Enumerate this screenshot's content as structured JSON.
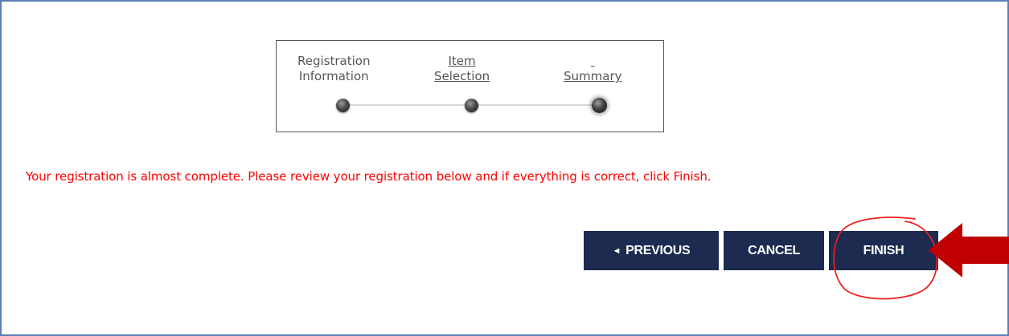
{
  "wizard": {
    "steps": [
      {
        "line1": "Registration",
        "line2": "Information",
        "linked": false
      },
      {
        "line1": "Item",
        "line2": "Selection",
        "linked": true
      },
      {
        "line1": "",
        "line2": "Summary",
        "linked": true
      }
    ],
    "current_step": 3
  },
  "message": {
    "text": "Your registration is almost complete. Please review your registration below and if everything is correct, click Finish.",
    "color": "#ff0000"
  },
  "buttons": {
    "previous_icon": "◄",
    "previous_label": "PREVIOUS",
    "cancel_label": "CANCEL",
    "finish_label": "FINISH",
    "color": "#1c2b4f"
  },
  "annotations": {
    "arrow_color": "#c00000",
    "circle_color": "#e8201f"
  }
}
